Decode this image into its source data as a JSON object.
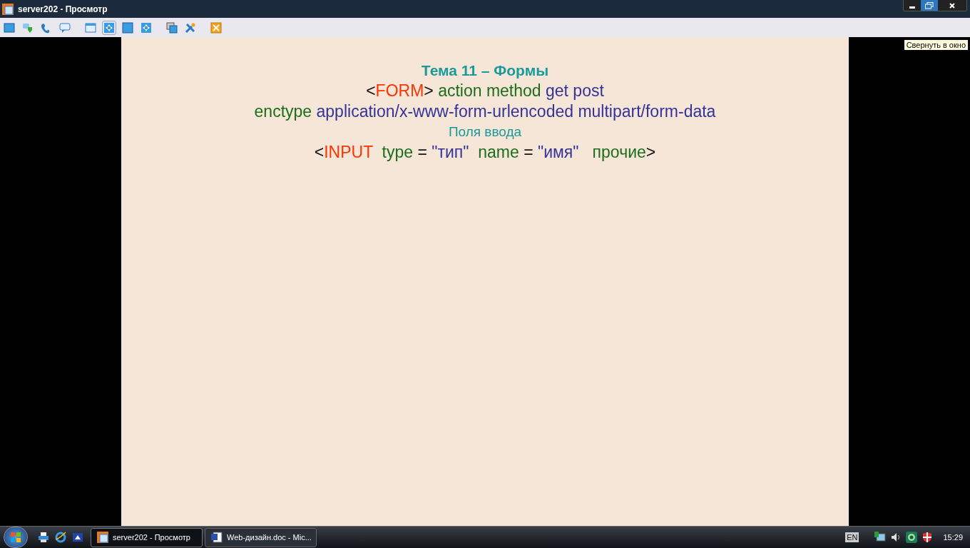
{
  "window": {
    "title": "server202 - Просмотр"
  },
  "toolbar": [
    {
      "selected": false
    },
    {
      "selected": false
    },
    {
      "selected": false
    },
    {
      "selected": false
    },
    {
      "selected": false
    },
    {
      "selected": true
    },
    {
      "selected": false
    },
    {
      "selected": false
    },
    {
      "selected": false
    },
    {
      "selected": false
    },
    {
      "selected": false
    }
  ],
  "tooltip": "Свернуть в окно",
  "slide": {
    "title": "Тема 11 – Формы",
    "lines": [
      {
        "segments": [
          {
            "text": "<",
            "kind": "punct"
          },
          {
            "text": "FORM",
            "kind": "tag"
          },
          {
            "text": "> ",
            "kind": "punct"
          },
          {
            "text": "action method ",
            "kind": "attr"
          },
          {
            "text": "get post",
            "kind": "value"
          }
        ]
      },
      {
        "segments": [
          {
            "text": "enctype ",
            "kind": "attr"
          },
          {
            "text": "application/x-www-form-urlencoded multipart/form-data",
            "kind": "value"
          }
        ]
      },
      {
        "segments": [
          {
            "text": "Поля ввода",
            "kind": "heading"
          }
        ]
      },
      {
        "segments": [
          {
            "text": "<",
            "kind": "punct"
          },
          {
            "text": "INPUT",
            "kind": "tag"
          },
          {
            "text": "  type",
            "kind": "attr"
          },
          {
            "text": " = ",
            "kind": "punct"
          },
          {
            "text": "\"тип\"",
            "kind": "value"
          },
          {
            "text": "  name",
            "kind": "attr"
          },
          {
            "text": " = ",
            "kind": "punct"
          },
          {
            "text": "\"имя\"",
            "kind": "value"
          },
          {
            "text": "   прочие",
            "kind": "attr"
          },
          {
            "text": ">",
            "kind": "punct"
          }
        ]
      }
    ]
  },
  "taskbar": {
    "tasks": [
      {
        "label": "server202 - Просмотр",
        "selected": true
      },
      {
        "label": "Web-дизайн.doc - Mic...",
        "selected": false
      }
    ],
    "language": "EN",
    "clock": "15:29"
  }
}
